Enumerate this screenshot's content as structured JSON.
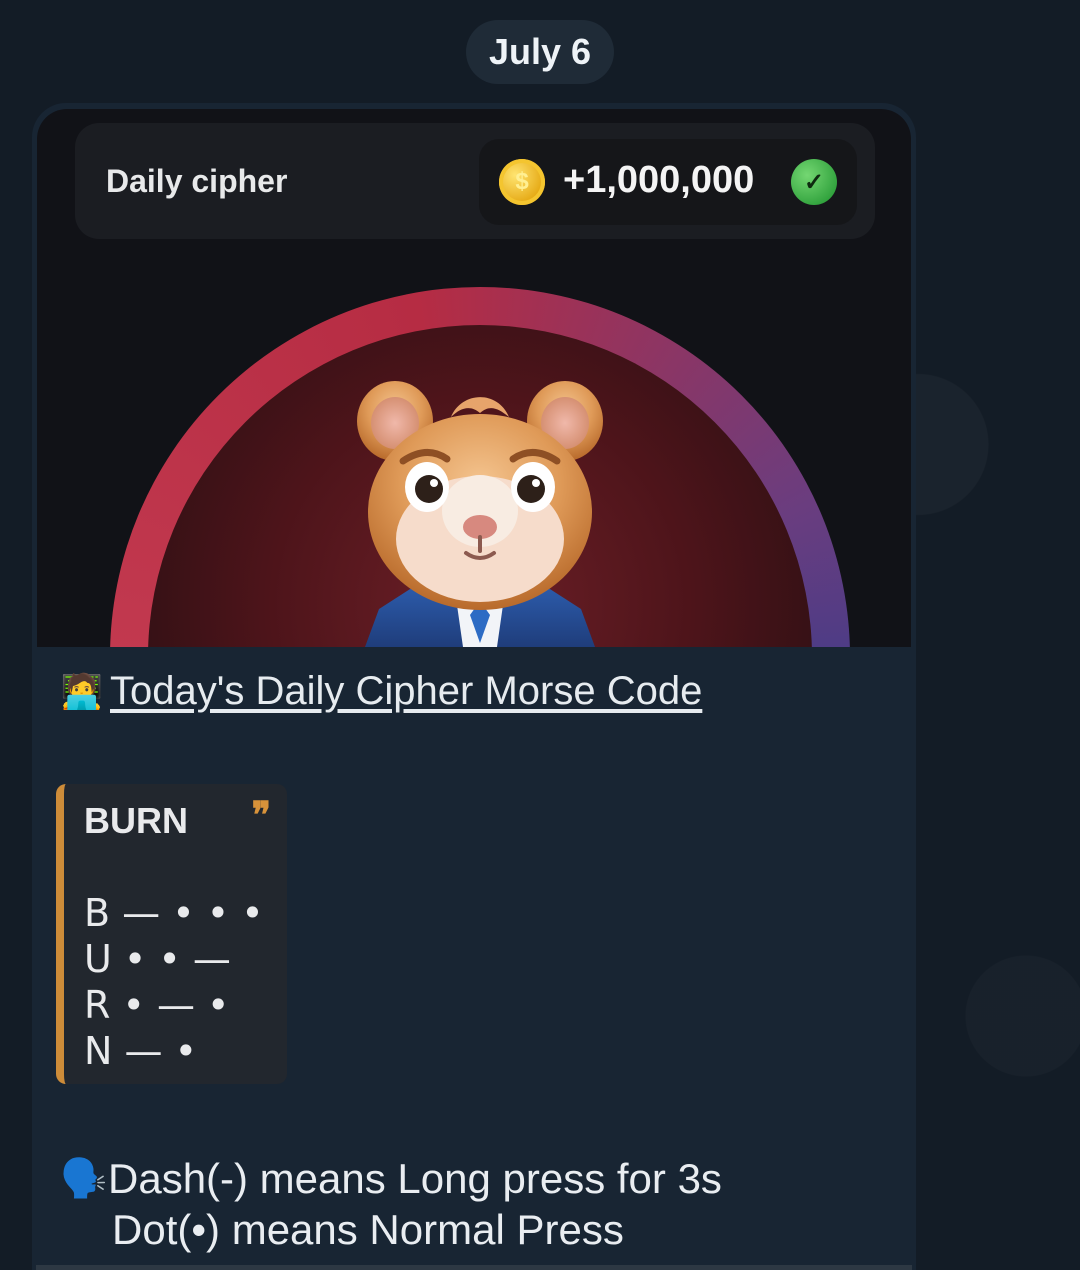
{
  "date_chip": "July 6",
  "card": {
    "reward_title": "Daily cipher",
    "reward_amount": "+1,000,000",
    "coin_icon": "coin-icon",
    "check_icon": "check-circle-icon"
  },
  "message": {
    "link_emoji": "🧑‍💻",
    "link_text": "Today's Daily Cipher Morse Code",
    "quote": {
      "title": "BURN",
      "quote_icon": "❞",
      "lines": [
        "B — • • •",
        "U • • —",
        "R • — •",
        "N — •"
      ]
    },
    "instructions": {
      "speaker_emoji": "🗣️",
      "line_1": "Dash(-) means Long press for 3s",
      "line_2": "Dot(•) means Normal Press"
    }
  },
  "colors": {
    "background": "#131c26",
    "bubble": "#182533",
    "quote_accent": "#cd8c39",
    "reward_check": "#2d9f3a",
    "arc_red": "#c2394f",
    "arc_blue": "#473c87"
  }
}
